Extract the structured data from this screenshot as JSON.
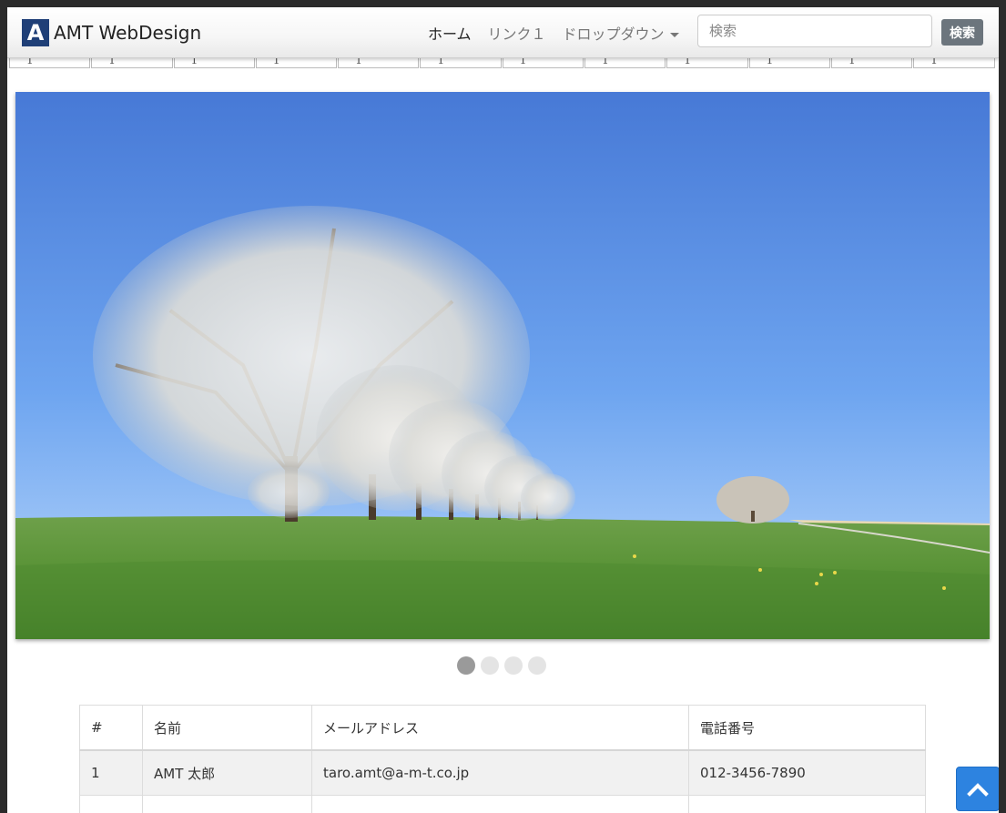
{
  "navbar": {
    "logo_letter": "A",
    "brand": "AMT WebDesign",
    "items": [
      {
        "label": "ホーム",
        "active": true
      },
      {
        "label": "リンク１",
        "active": false
      },
      {
        "label": "ドロップダウン",
        "active": false,
        "dropdown": true
      }
    ],
    "search_placeholder": "検索",
    "search_button": "検索"
  },
  "cell_row": [
    "1",
    "1",
    "1",
    "1",
    "1",
    "1",
    "1",
    "1",
    "1",
    "1",
    "1",
    "1"
  ],
  "carousel": {
    "image": "blossoming-trees-meadow-image",
    "slide_count": 4,
    "active_index": 0
  },
  "table": {
    "headers": [
      "#",
      "名前",
      "メールアドレス",
      "電話番号"
    ],
    "rows": [
      [
        "1",
        "AMT 太郎",
        "taro.amt@a-m-t.co.jp",
        "012-3456-7890"
      ],
      [
        "",
        "",
        "",
        ""
      ]
    ]
  },
  "scroll_top_icon": "chevron-up-icon",
  "colors": {
    "logo_bg": "#1f3f77",
    "search_button_bg": "#6c757d",
    "scroll_top_bg": "#2d83e0"
  }
}
